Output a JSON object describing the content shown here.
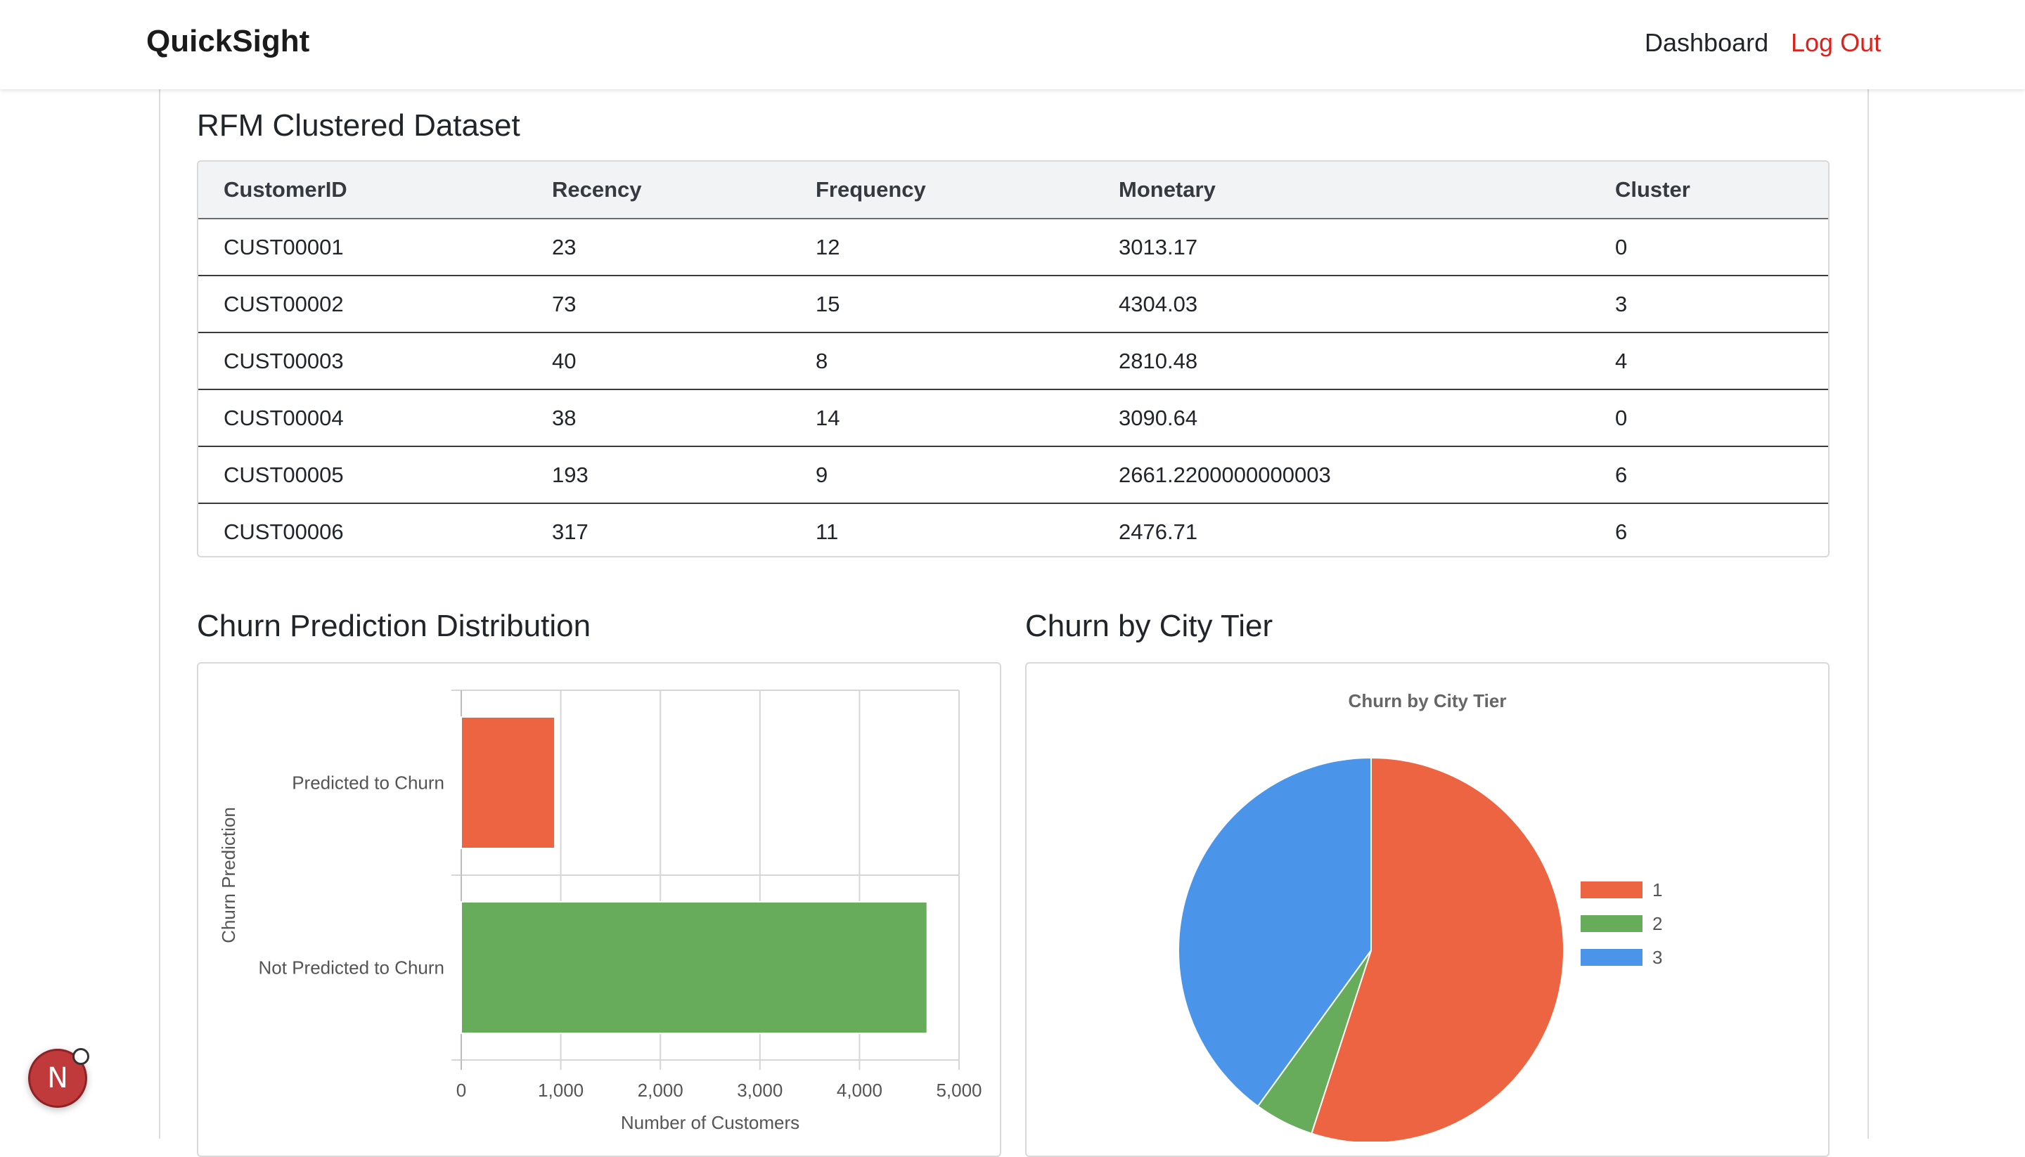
{
  "navbar": {
    "brand": "QuickSight",
    "links": {
      "dashboard": "Dashboard",
      "logout": "Log Out"
    },
    "logout_color": "#d9241e"
  },
  "rfm_table": {
    "title": "RFM Clustered Dataset",
    "columns": [
      "CustomerID",
      "Recency",
      "Frequency",
      "Monetary",
      "Cluster"
    ],
    "rows": [
      [
        "CUST00001",
        "23",
        "12",
        "3013.17",
        "0"
      ],
      [
        "CUST00002",
        "73",
        "15",
        "4304.03",
        "3"
      ],
      [
        "CUST00003",
        "40",
        "8",
        "2810.48",
        "4"
      ],
      [
        "CUST00004",
        "38",
        "14",
        "3090.64",
        "0"
      ],
      [
        "CUST00005",
        "193",
        "9",
        "2661.2200000000003",
        "6"
      ],
      [
        "CUST00006",
        "317",
        "11",
        "2476.71",
        "6"
      ]
    ]
  },
  "sections": {
    "churn_distribution_title": "Churn Prediction Distribution",
    "churn_city_title": "Churn by City Tier"
  },
  "floating_button": {
    "letter": "N"
  },
  "chart_data": [
    {
      "type": "bar",
      "orientation": "horizontal",
      "categories": [
        "Predicted to Churn",
        "Not Predicted to Churn"
      ],
      "values": [
        940,
        4680
      ],
      "colors": [
        "#ec6442",
        "#67ac5b"
      ],
      "title": "",
      "xlabel": "Number of Customers",
      "ylabel": "Churn Prediction",
      "xlim": [
        0,
        5000
      ],
      "xticks": [
        "0",
        "1,000",
        "2,000",
        "3,000",
        "4,000",
        "5,000"
      ],
      "grid": true
    },
    {
      "type": "pie",
      "title": "Churn by City Tier",
      "labels": [
        "1",
        "2",
        "3"
      ],
      "values": [
        55,
        5,
        40
      ],
      "colors": [
        "#ec6442",
        "#67ac5b",
        "#4a94ea"
      ],
      "legend": "right"
    }
  ]
}
